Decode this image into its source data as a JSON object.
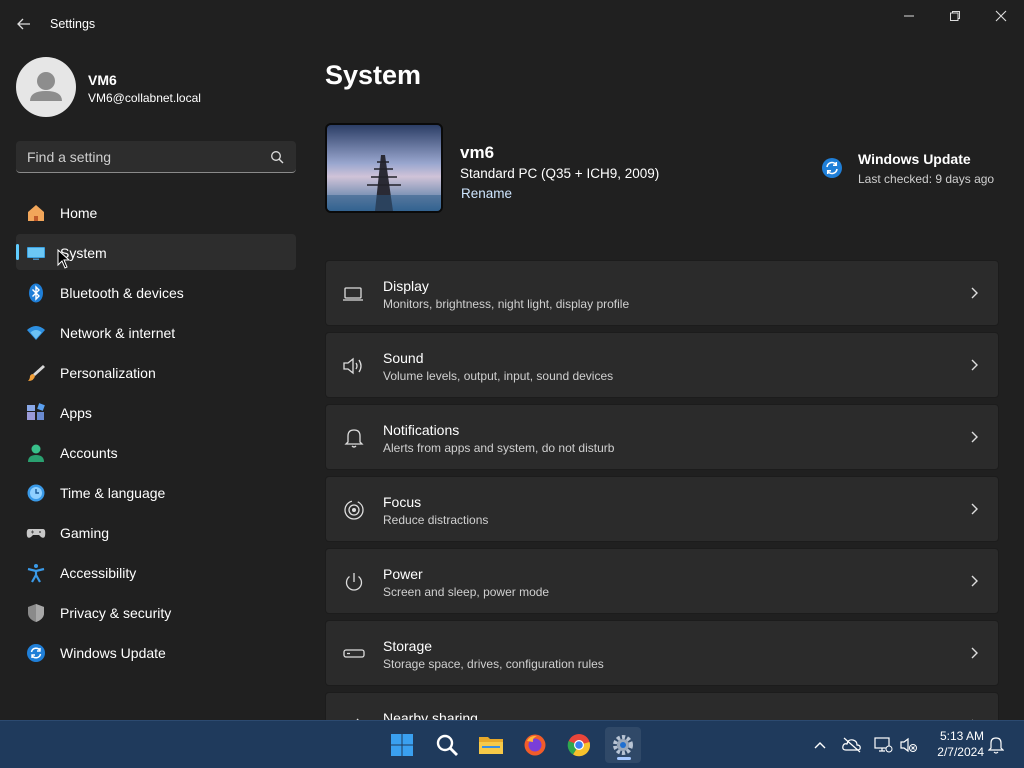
{
  "window": {
    "title": "Settings",
    "controls": {
      "minimize": "minimize-icon",
      "maximize": "restore-icon",
      "close": "close-icon"
    }
  },
  "profile": {
    "name": "VM6",
    "email": "VM6@collabnet.local"
  },
  "search": {
    "placeholder": "Find a setting"
  },
  "nav": {
    "items": [
      {
        "label": "Home",
        "icon": "home-icon"
      },
      {
        "label": "System",
        "icon": "system-icon",
        "selected": true
      },
      {
        "label": "Bluetooth & devices",
        "icon": "bluetooth-icon"
      },
      {
        "label": "Network & internet",
        "icon": "network-icon"
      },
      {
        "label": "Personalization",
        "icon": "brush-icon"
      },
      {
        "label": "Apps",
        "icon": "apps-icon"
      },
      {
        "label": "Accounts",
        "icon": "accounts-icon"
      },
      {
        "label": "Time & language",
        "icon": "time-language-icon"
      },
      {
        "label": "Gaming",
        "icon": "gaming-icon"
      },
      {
        "label": "Accessibility",
        "icon": "accessibility-icon"
      },
      {
        "label": "Privacy & security",
        "icon": "shield-icon"
      },
      {
        "label": "Windows Update",
        "icon": "windows-update-icon"
      }
    ]
  },
  "main": {
    "title": "System",
    "device": {
      "name": "vm6",
      "model": "Standard PC (Q35 + ICH9, 2009)",
      "rename_label": "Rename"
    },
    "update": {
      "title": "Windows Update",
      "subtitle": "Last checked: 9 days ago"
    },
    "cards": [
      {
        "title": "Display",
        "subtitle": "Monitors, brightness, night light, display profile",
        "icon": "display-icon"
      },
      {
        "title": "Sound",
        "subtitle": "Volume levels, output, input, sound devices",
        "icon": "speaker-icon"
      },
      {
        "title": "Notifications",
        "subtitle": "Alerts from apps and system, do not disturb",
        "icon": "bell-icon"
      },
      {
        "title": "Focus",
        "subtitle": "Reduce distractions",
        "icon": "focus-icon"
      },
      {
        "title": "Power",
        "subtitle": "Screen and sleep, power mode",
        "icon": "power-icon"
      },
      {
        "title": "Storage",
        "subtitle": "Storage space, drives, configuration rules",
        "icon": "storage-icon"
      },
      {
        "title": "Nearby sharing",
        "subtitle": "",
        "icon": "share-icon"
      }
    ]
  },
  "taskbar": {
    "apps": [
      "start-icon",
      "search-icon",
      "file-explorer-icon",
      "firefox-icon",
      "chrome-icon",
      "settings-icon"
    ],
    "tray": [
      "chevron-up-icon",
      "cloud-off-icon",
      "network-disconnected-icon",
      "volume-muted-icon",
      "notification-bell-icon"
    ],
    "time": "5:13 AM",
    "date": "2/7/2024"
  },
  "colors": {
    "accent": "#60cdff",
    "background": "#202020",
    "card": "#2b2b2b",
    "taskbar": "#1f3a5c"
  }
}
